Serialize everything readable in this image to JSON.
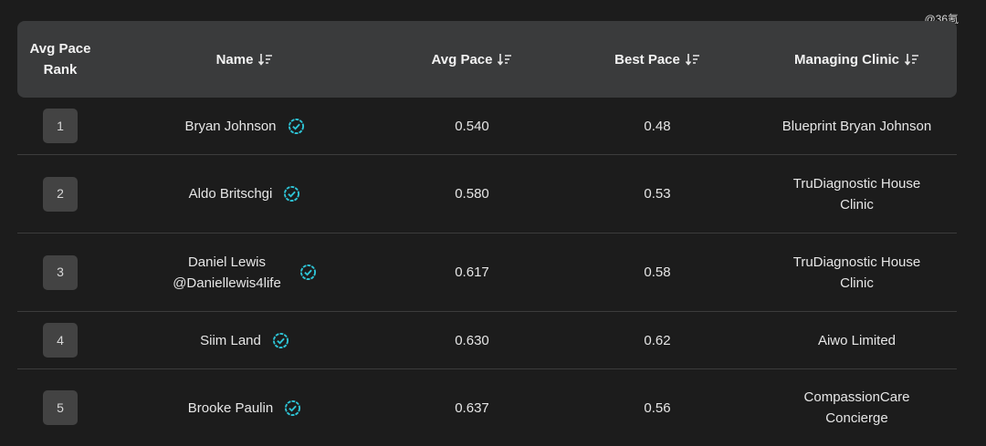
{
  "watermark": "@36氪",
  "colors": {
    "background": "#1c1c1c",
    "header_bg": "#3a3b3c",
    "verified": "#2ec4d6",
    "badge_bg": "#434343"
  },
  "columns": [
    {
      "label": "Avg Pace Rank",
      "line1": "Avg Pace",
      "line2": "Rank",
      "sortable": false
    },
    {
      "label": "Name",
      "sortable": true
    },
    {
      "label": "Avg Pace",
      "sortable": true
    },
    {
      "label": "Best Pace",
      "sortable": true
    },
    {
      "label": "Managing Clinic",
      "sortable": true
    }
  ],
  "rows": [
    {
      "rank": "1",
      "name_line1": "Bryan Johnson",
      "name_line2": "",
      "avg_pace": "0.540",
      "best_pace": "0.48",
      "clinic_line1": "Blueprint Bryan Johnson",
      "clinic_line2": "",
      "verified": true
    },
    {
      "rank": "2",
      "name_line1": "Aldo Britschgi",
      "name_line2": "",
      "avg_pace": "0.580",
      "best_pace": "0.53",
      "clinic_line1": "TruDiagnostic House",
      "clinic_line2": "Clinic",
      "verified": true
    },
    {
      "rank": "3",
      "name_line1": "Daniel Lewis",
      "name_line2": "@Daniellewis4life",
      "avg_pace": "0.617",
      "best_pace": "0.58",
      "clinic_line1": "TruDiagnostic House",
      "clinic_line2": "Clinic",
      "verified": true
    },
    {
      "rank": "4",
      "name_line1": "Siim Land",
      "name_line2": "",
      "avg_pace": "0.630",
      "best_pace": "0.62",
      "clinic_line1": "Aiwo Limited",
      "clinic_line2": "",
      "verified": true
    },
    {
      "rank": "5",
      "name_line1": "Brooke Paulin",
      "name_line2": "",
      "avg_pace": "0.637",
      "best_pace": "0.56",
      "clinic_line1": "CompassionCare",
      "clinic_line2": "Concierge",
      "verified": true
    }
  ]
}
